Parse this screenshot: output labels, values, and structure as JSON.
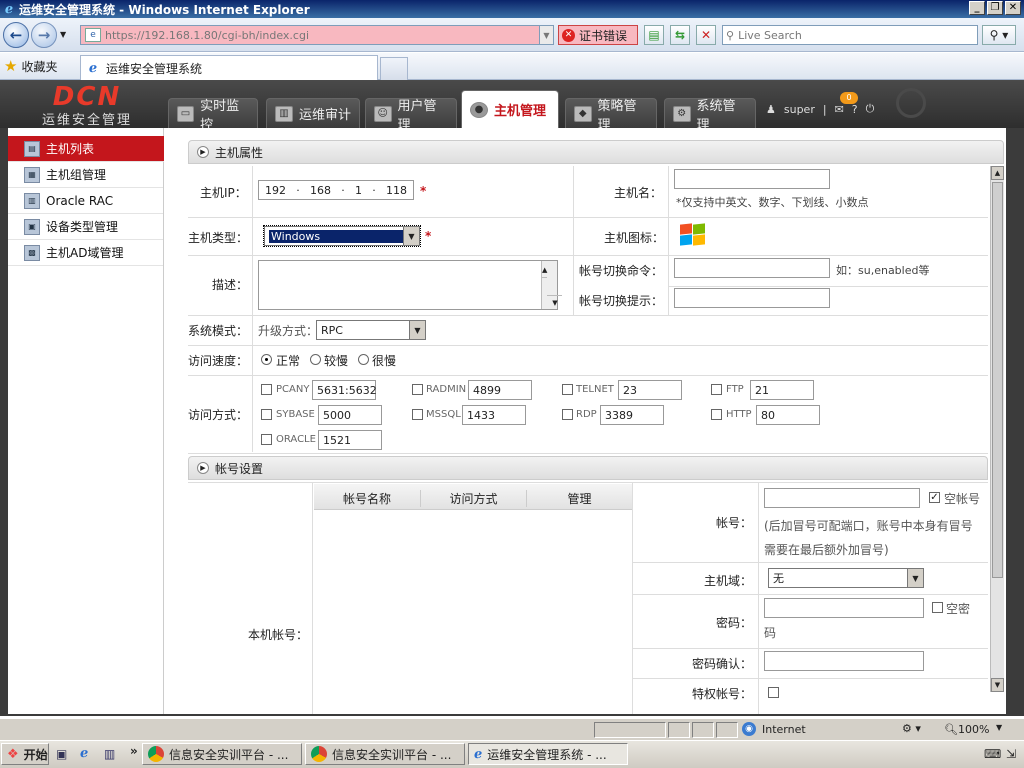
{
  "window": {
    "title": "运维安全管理系统 - Windows Internet Explorer",
    "controls": [
      "_",
      "❐",
      "✕"
    ]
  },
  "browser": {
    "address": "https://192.168.1.80/cgi-bh/index.cgi",
    "cert_error": "证书错误",
    "search_placeholder": "Live Search",
    "favorites_label": "收藏夹",
    "tab_title": "运维安全管理系统"
  },
  "app": {
    "brand": {
      "logo": "DCN",
      "subtitle": "运维安全管理"
    },
    "nav": [
      {
        "label": "实时监控"
      },
      {
        "label": "运维审计"
      },
      {
        "label": "用户管理"
      },
      {
        "label": "主机管理",
        "active": true
      },
      {
        "label": "策略管理"
      },
      {
        "label": "系统管理"
      }
    ],
    "user": "super",
    "message_count": "0",
    "sidebar": [
      {
        "label": "主机列表",
        "active": true
      },
      {
        "label": "主机组管理"
      },
      {
        "label": "Oracle RAC"
      },
      {
        "label": "设备类型管理"
      },
      {
        "label": "主机AD域管理"
      }
    ]
  },
  "host_props": {
    "section_title": "主机属性",
    "ip_label": "主机IP：",
    "ip": [
      "192",
      "168",
      "1",
      "118"
    ],
    "name_label": "主机名：",
    "name_value": "",
    "name_hint": "*仅支持中英文、数字、下划线、小数点",
    "type_label": "主机类型：",
    "type_value": "Windows",
    "icon_label": "主机图标：",
    "desc_label": "描述：",
    "switch_cmd_label": "帐号切换命令：",
    "switch_cmd_hint": "如：su,enabled等",
    "switch_prompt_label": "帐号切换提示：",
    "sys_mode_label": "系统模式：",
    "upgrade_label": "升级方式：",
    "upgrade_value": "RPC",
    "speed_label": "访问速度：",
    "speed_options": [
      {
        "label": "正常",
        "checked": true
      },
      {
        "label": "较慢"
      },
      {
        "label": "很慢"
      }
    ],
    "access_label": "访问方式：",
    "access": [
      {
        "name": "PCANY",
        "port": "5631:5632"
      },
      {
        "name": "RADMIN",
        "port": "4899"
      },
      {
        "name": "TELNET",
        "port": "23"
      },
      {
        "name": "FTP",
        "port": "21"
      },
      {
        "name": "SYBASE",
        "port": "5000"
      },
      {
        "name": "MSSQL",
        "port": "1433"
      },
      {
        "name": "RDP",
        "port": "3389"
      },
      {
        "name": "HTTP",
        "port": "80"
      },
      {
        "name": "ORACLE",
        "port": "1521"
      }
    ]
  },
  "account": {
    "section_title": "帐号设置",
    "local_label": "本机帐号：",
    "table_headers": [
      "帐号名称",
      "访问方式",
      "管理"
    ],
    "acc_label": "帐号：",
    "empty_account": "空帐号",
    "acc_hint": "(后加冒号可配端口，账号中本身有冒号需要在最后额外加冒号)",
    "domain_label": "主机域：",
    "domain_value": "无",
    "pwd_label": "密码：",
    "empty_pwd": "空密码",
    "pwd_confirm_label": "密码确认：",
    "special_label": "特权帐号："
  },
  "statusbar": {
    "zone": "Internet",
    "zoom": "100%"
  },
  "taskbar": {
    "start": "开始",
    "items": [
      {
        "label": "信息安全实训平台 - ..."
      },
      {
        "label": "信息安全实训平台 - ..."
      },
      {
        "label": "运维安全管理系统 - ...",
        "active": true
      }
    ]
  }
}
